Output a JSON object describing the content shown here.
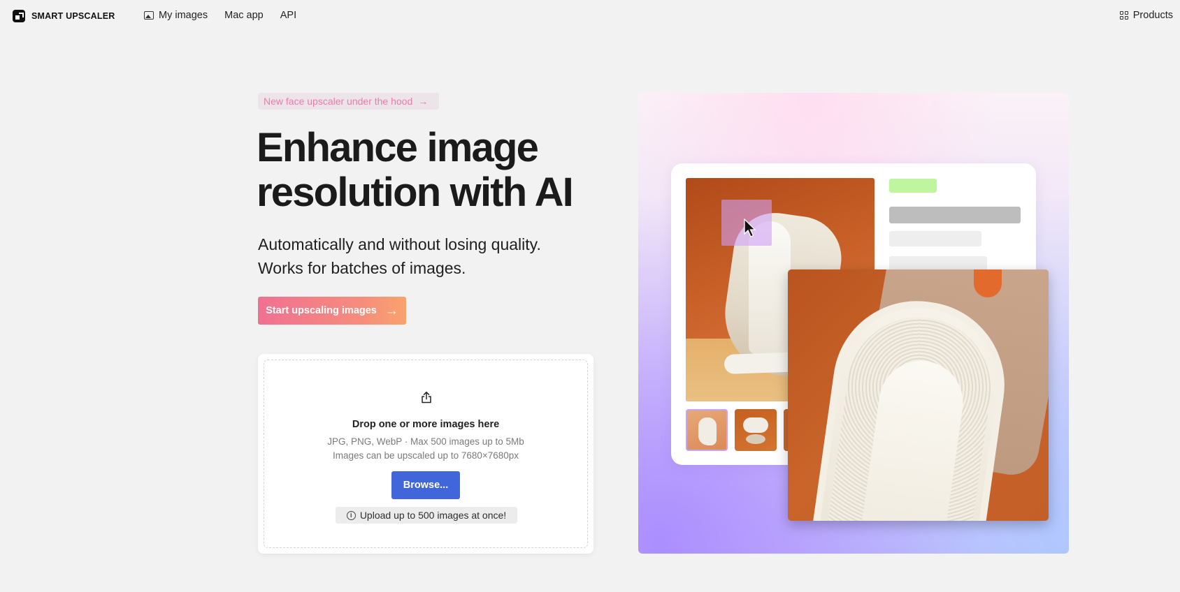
{
  "header": {
    "logo_text": "SMART UPSCALER",
    "nav": [
      {
        "label": "My images",
        "icon": "image-icon"
      },
      {
        "label": "Mac app"
      },
      {
        "label": "API"
      }
    ],
    "products_label": "Products"
  },
  "hero": {
    "badge": "New face upscaler under the hood",
    "headline_line1": "Enhance image",
    "headline_line2": "resolution with AI",
    "sub_line1": "Automatically and without losing quality.",
    "sub_line2": "Works for batches of images.",
    "cta_label": "Start upscaling images"
  },
  "upload": {
    "title": "Drop one or more images here",
    "info_line1": "JPG, PNG, WebP · Max 500 images up to 5Mb",
    "info_line2": "Images can be upscaled up to 7680×7680px",
    "browse_label": "Browse...",
    "note": "Upload up to 500 images at once!"
  },
  "colors": {
    "cta_gradient_start": "#f07092",
    "cta_gradient_end": "#f8a36d",
    "browse_button": "#4165da",
    "badge_text": "#ec7aa9",
    "page_background": "#f2f2f2"
  }
}
